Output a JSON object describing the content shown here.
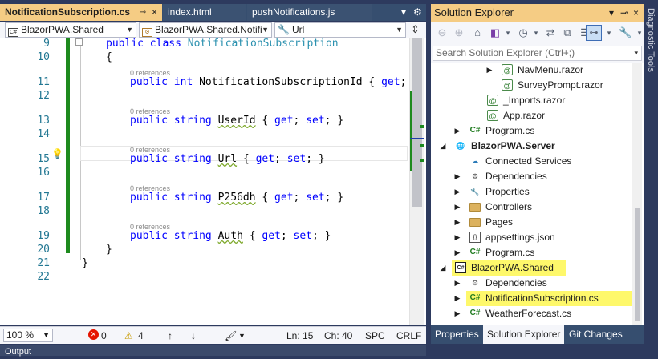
{
  "editor_tabs": [
    {
      "label": "NotificationSubscription.cs",
      "active": true
    },
    {
      "label": "index.html",
      "active": false
    },
    {
      "label": "pushNotifications.js",
      "active": false
    }
  ],
  "tab_controls": {
    "pin": "⊸",
    "close": "×",
    "dropdown": "▾",
    "settings": "⚙"
  },
  "navbar": {
    "project": "BlazorPWA.Shared",
    "type": "BlazorPWA.Shared.Notifi",
    "member": "Url",
    "split_icon": "split-editor-icon"
  },
  "code_lines": [
    {
      "num": "9",
      "tokens": [
        {
          "t": "public ",
          "c": "kw"
        },
        {
          "t": "class ",
          "c": "kw"
        },
        {
          "t": "NotificationSubscription",
          "c": "ty"
        }
      ],
      "indent": 0
    },
    {
      "num": "10",
      "tokens": [
        {
          "t": "{",
          "c": ""
        }
      ],
      "indent": 0
    },
    {
      "num": "11",
      "lens": "0 references",
      "tokens": [
        {
          "t": "public ",
          "c": "kw"
        },
        {
          "t": "int ",
          "c": "kw"
        },
        {
          "t": "NotificationSubscriptionId { ",
          "c": ""
        },
        {
          "t": "get",
          "c": "kw"
        },
        {
          "t": ";",
          "c": ""
        }
      ],
      "indent": 1
    },
    {
      "num": "12",
      "tokens": [],
      "indent": 1
    },
    {
      "num": "13",
      "lens": "0 references",
      "tokens": [
        {
          "t": "public ",
          "c": "kw"
        },
        {
          "t": "string ",
          "c": "kw"
        },
        {
          "t": "UserId",
          "c": "squig"
        },
        {
          "t": " { ",
          "c": ""
        },
        {
          "t": "get",
          "c": "kw"
        },
        {
          "t": "; ",
          "c": ""
        },
        {
          "t": "set",
          "c": "kw"
        },
        {
          "t": "; }",
          "c": ""
        }
      ],
      "indent": 1
    },
    {
      "num": "14",
      "tokens": [],
      "indent": 1
    },
    {
      "num": "15",
      "lens": "0 references",
      "tokens": [
        {
          "t": "public ",
          "c": "kw"
        },
        {
          "t": "string ",
          "c": "kw"
        },
        {
          "t": "Url",
          "c": "squig"
        },
        {
          "t": " { ",
          "c": ""
        },
        {
          "t": "get",
          "c": "kw"
        },
        {
          "t": "; ",
          "c": ""
        },
        {
          "t": "set",
          "c": "kw"
        },
        {
          "t": "; }",
          "c": ""
        }
      ],
      "indent": 1
    },
    {
      "num": "16",
      "tokens": [],
      "indent": 1
    },
    {
      "num": "17",
      "lens": "0 references",
      "tokens": [
        {
          "t": "public ",
          "c": "kw"
        },
        {
          "t": "string ",
          "c": "kw"
        },
        {
          "t": "P256dh",
          "c": "squig"
        },
        {
          "t": " { ",
          "c": ""
        },
        {
          "t": "get",
          "c": "kw"
        },
        {
          "t": "; ",
          "c": ""
        },
        {
          "t": "set",
          "c": "kw"
        },
        {
          "t": "; }",
          "c": ""
        }
      ],
      "indent": 1
    },
    {
      "num": "18",
      "tokens": [],
      "indent": 1
    },
    {
      "num": "19",
      "lens": "0 references",
      "tokens": [
        {
          "t": "public ",
          "c": "kw"
        },
        {
          "t": "string ",
          "c": "kw"
        },
        {
          "t": "Auth",
          "c": "squig"
        },
        {
          "t": " { ",
          "c": ""
        },
        {
          "t": "get",
          "c": "kw"
        },
        {
          "t": "; ",
          "c": ""
        },
        {
          "t": "set",
          "c": "kw"
        },
        {
          "t": "; }",
          "c": ""
        }
      ],
      "indent": 1
    },
    {
      "num": "20",
      "tokens": [
        {
          "t": "}",
          "c": ""
        }
      ],
      "indent": 0
    },
    {
      "num": "21",
      "tokens": [
        {
          "t": "}",
          "c": ""
        }
      ],
      "indent": -1
    },
    {
      "num": "22",
      "tokens": [],
      "indent": 0
    }
  ],
  "status": {
    "zoom": "100 %",
    "errors": "0",
    "warnings": "4",
    "line": "Ln: 15",
    "col": "Ch: 40",
    "spc": "SPC",
    "eol": "CRLF"
  },
  "output_label": "Output",
  "solution_explorer": {
    "title": "Solution Explorer",
    "title_controls": {
      "dropdown": "▾",
      "pin": "⊸",
      "close": "×"
    },
    "search_placeholder": "Search Solution Explorer (Ctrl+;)",
    "tree": [
      {
        "label": "NavMenu.razor",
        "icon": "razor",
        "expander": "▶",
        "level": 3
      },
      {
        "label": "SurveyPrompt.razor",
        "icon": "razor",
        "expander": "",
        "level": 3
      },
      {
        "label": "_Imports.razor",
        "icon": "razor",
        "expander": "",
        "level": 2
      },
      {
        "label": "App.razor",
        "icon": "razor",
        "expander": "",
        "level": 2
      },
      {
        "label": "Program.cs",
        "icon": "cs",
        "expander": "▶",
        "level": 1
      },
      {
        "label": "BlazorPWA.Server",
        "icon": "globe",
        "expander": "◢",
        "level": 0,
        "bold": true
      },
      {
        "label": "Connected Services",
        "icon": "cloud",
        "expander": "",
        "level": 1
      },
      {
        "label": "Dependencies",
        "icon": "dep",
        "expander": "▶",
        "level": 1
      },
      {
        "label": "Properties",
        "icon": "gear",
        "expander": "▶",
        "level": 1
      },
      {
        "label": "Controllers",
        "icon": "folder",
        "expander": "▶",
        "level": 1
      },
      {
        "label": "Pages",
        "icon": "folder",
        "expander": "▶",
        "level": 1
      },
      {
        "label": "appsettings.json",
        "icon": "json",
        "expander": "▶",
        "level": 1
      },
      {
        "label": "Program.cs",
        "icon": "cs",
        "expander": "▶",
        "level": 1
      },
      {
        "label": "BlazorPWA.Shared",
        "icon": "proj",
        "expander": "◢",
        "level": 0,
        "highlight": true
      },
      {
        "label": "Dependencies",
        "icon": "dep",
        "expander": "▶",
        "level": 1
      },
      {
        "label": "NotificationSubscription.cs",
        "icon": "cs",
        "expander": "▶",
        "level": 1,
        "highlight": true
      },
      {
        "label": "WeatherForecast.cs",
        "icon": "cs",
        "expander": "▶",
        "level": 1
      }
    ],
    "bottom_tabs": [
      {
        "label": "Properties",
        "active": false
      },
      {
        "label": "Solution Explorer",
        "active": true
      },
      {
        "label": "Git Changes",
        "active": false
      }
    ]
  },
  "side_panel_label": "Diagnostic Tools",
  "colors": {
    "accent_tab": "#f5cc84",
    "highlight": "#fef86b",
    "keyword": "#0000ff",
    "type": "#2b91af",
    "line_number": "#237893",
    "change_bar": "#1e8a1e"
  }
}
